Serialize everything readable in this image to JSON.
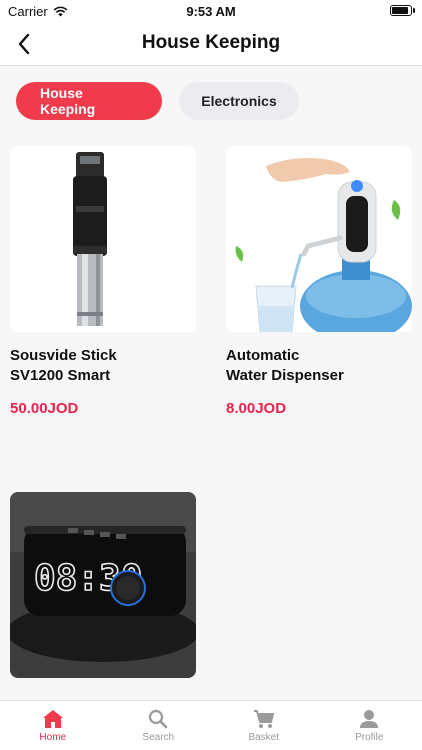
{
  "status_bar": {
    "carrier": "Carrier",
    "time": "9:53 AM",
    "battery_level": 0.95
  },
  "nav": {
    "title": "House Keeping",
    "back_icon": "chevron-left-icon"
  },
  "tabs": [
    {
      "label": "House Keeping",
      "active": true
    },
    {
      "label": "Electronics",
      "active": false
    }
  ],
  "products": [
    {
      "name": "Sousvide Stick\nSV1200 Smart",
      "price": "50.00JOD"
    },
    {
      "name": "Automatic\nWater Dispenser",
      "price": "8.00JOD"
    },
    {
      "name": "",
      "price": ""
    }
  ],
  "tab_bar": [
    {
      "label": "Home",
      "icon": "home-icon",
      "active": true
    },
    {
      "label": "Search",
      "icon": "search-icon",
      "active": false
    },
    {
      "label": "Basket",
      "icon": "cart-icon",
      "active": false
    },
    {
      "label": "Profile",
      "icon": "profile-icon",
      "active": false
    }
  ],
  "colors": {
    "accent": "#ef3b4b",
    "price": "#e8264c",
    "inactive": "#9a9a9a"
  }
}
